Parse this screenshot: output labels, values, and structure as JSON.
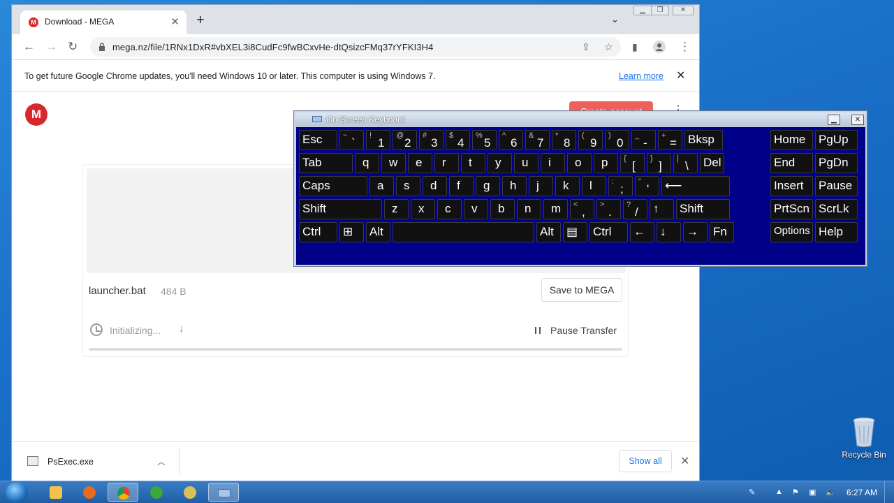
{
  "browser": {
    "tab_title": "Download - MEGA",
    "tab_favicon": "M",
    "url": "mega.nz/file/1RNx1DxR#vbXEL3i8CudFc9fwBCxvHe-dtQsizcFMq37rYFKI3H4"
  },
  "infobar": {
    "message": "To get future Google Chrome updates, you'll need Windows 10 or later. This computer is using Windows 7.",
    "learn_more": "Learn more"
  },
  "mega": {
    "logo": "M",
    "create_account": "Create account",
    "file_name": "launcher.bat",
    "file_size": "484 B",
    "save_button": "Save to MEGA",
    "status": "Initializing...",
    "pause_label": "Pause Transfer",
    "progress": 0
  },
  "downloads": {
    "file": "PsExec.exe",
    "show_all": "Show all"
  },
  "osk": {
    "title": "On-Screen Keyboard"
  },
  "desktop": {
    "recycle_bin": "Recycle Bin"
  },
  "taskbar": {
    "time": "6:27 AM"
  },
  "colors": {
    "mega_red": "#d9272e",
    "osk_background": "#000088",
    "chrome_link": "#1a73e8"
  }
}
